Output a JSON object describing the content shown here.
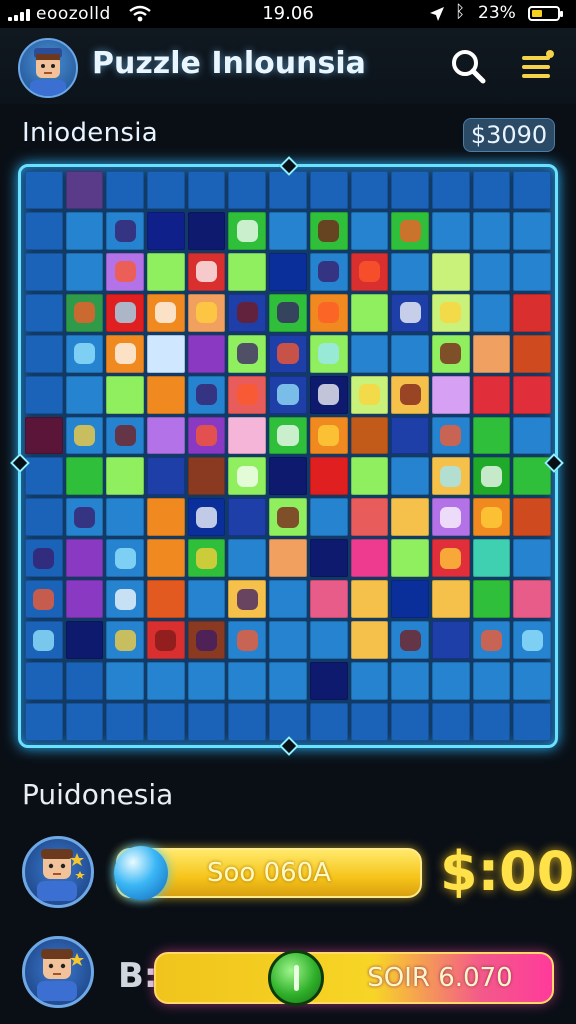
{
  "status_bar": {
    "carrier": "eoozolld",
    "time": "19.06",
    "battery": "23%"
  },
  "header": {
    "title": "Puzzle Inlounsia",
    "avatar_icon": "player-avatar-icon",
    "search_icon": "search-icon",
    "menu_icon": "hamburger-menu-icon"
  },
  "board": {
    "label": "Iniodensia",
    "score": "$3090",
    "border_color": "#68e2ff",
    "cells": [
      "#1a63b8",
      "#5a3b8a",
      "#1a63b8",
      "#1a63b8",
      "#1a63b8",
      "#1a63b8",
      "#1a63b8",
      "#1a63b8",
      "#1a63b8",
      "#1a63b8",
      "#1a63b8",
      "#1a63b8",
      "#1a63b8",
      "#1a63b8",
      "#2583d0",
      "#2583d0",
      "#10208a",
      "#0e1a6e",
      "#2fbf3a",
      "#2583d0",
      "#2fbf3a",
      "#2583d0",
      "#2fbf3a",
      "#2583d0",
      "#2583d0",
      "#2583d0",
      "#1a63b8",
      "#2583d0",
      "#b472e8",
      "#8fef5e",
      "#d92f2f",
      "#8fef5e",
      "#0b2f9a",
      "#2583d0",
      "#d92f2f",
      "#2583d0",
      "#c9f27a",
      "#2583d0",
      "#2583d0",
      "#1a63b8",
      "#2f9b4a",
      "#e02020",
      "#f08a20",
      "#f2a060",
      "#1e3ea8",
      "#2fbf3a",
      "#f08a20",
      "#8fef5e",
      "#1e3ea8",
      "#c9f27a",
      "#2583d0",
      "#d92f2f",
      "#1a63b8",
      "#2583d0",
      "#f08a20",
      "#cfe8ff",
      "#8a3ac2",
      "#8fef5e",
      "#1e3ea8",
      "#8fef5e",
      "#2583d0",
      "#2583d0",
      "#8fef5e",
      "#f0a060",
      "#d04a20",
      "#1a63b8",
      "#2583d0",
      "#8fef5e",
      "#f08a20",
      "#2583d0",
      "#e85c5c",
      "#1e3ea8",
      "#0e1a6e",
      "#c9f27a",
      "#f6c14a",
      "#d6a0f5",
      "#e02e3a",
      "#e02e3a",
      "#5a1538",
      "#2583d0",
      "#2583d0",
      "#b472e8",
      "#8a3ac2",
      "#f5b5d8",
      "#2fbf3a",
      "#f08a20",
      "#c25a1a",
      "#1e3ea8",
      "#2583d0",
      "#2fbf3a",
      "#2583d0",
      "#1a63b8",
      "#2fbf3a",
      "#8fef5e",
      "#1e3ea8",
      "#8a3a20",
      "#8fef5e",
      "#0e1a6e",
      "#e02020",
      "#8fef5e",
      "#2583d0",
      "#f6c14a",
      "#1faa2a",
      "#2fbf3a",
      "#1a63b8",
      "#2583d0",
      "#2583d0",
      "#f08a20",
      "#0b2f9a",
      "#1e3ea8",
      "#8fef5e",
      "#2583d0",
      "#e85c5c",
      "#f6c14a",
      "#b472e8",
      "#f08a20",
      "#d04a20",
      "#1a63b8",
      "#8a3ac2",
      "#2583d0",
      "#f08a20",
      "#2fbf3a",
      "#2583d0",
      "#f2a060",
      "#0e1a6e",
      "#ef3b8f",
      "#8fef5e",
      "#e02e3a",
      "#3ed0b0",
      "#2583d0",
      "#1a63b8",
      "#8a3ac2",
      "#2583d0",
      "#e35a20",
      "#2583d0",
      "#f6c14a",
      "#2583d0",
      "#e85c8a",
      "#f6c14a",
      "#0b2f9a",
      "#f6c14a",
      "#2fbf3a",
      "#e85c8a",
      "#1a63b8",
      "#0e1a6e",
      "#2583d0",
      "#d92f2f",
      "#8a3a20",
      "#2583d0",
      "#2583d0",
      "#2583d0",
      "#f6c14a",
      "#2583d0",
      "#1e3ea8",
      "#2583d0",
      "#2583d0",
      "#1a63b8",
      "#1a63b8",
      "#2583d0",
      "#2583d0",
      "#2583d0",
      "#2583d0",
      "#2583d0",
      "#0e1a6e",
      "#2583d0",
      "#2583d0",
      "#2583d0",
      "#2583d0",
      "#2583d0",
      "#1a63b8",
      "#1a63b8",
      "#1a63b8",
      "#1a63b8",
      "#1a63b8",
      "#1a63b8",
      "#1a63b8",
      "#1a63b8",
      "#1a63b8",
      "#1a63b8",
      "#1a63b8",
      "#1a63b8",
      "#1a63b8"
    ],
    "marked": [
      15,
      18,
      20,
      22,
      28,
      30,
      33,
      34,
      40,
      41,
      42,
      43,
      44,
      45,
      46,
      48,
      49,
      53,
      54,
      57,
      58,
      59,
      62,
      69,
      70,
      71,
      72,
      73,
      74,
      79,
      80,
      82,
      84,
      85,
      88,
      96,
      101,
      102,
      105,
      108,
      110,
      114,
      115,
      117,
      119,
      121,
      127,
      130,
      132,
      135,
      143,
      145,
      146,
      147,
      148,
      152,
      154,
      155
    ]
  },
  "section": {
    "label": "Puidonesia"
  },
  "player1": {
    "bar_text": "Soo 060A",
    "value": "$:00"
  },
  "player2": {
    "label": "B:",
    "bar_text": "SOIR 6.070"
  }
}
